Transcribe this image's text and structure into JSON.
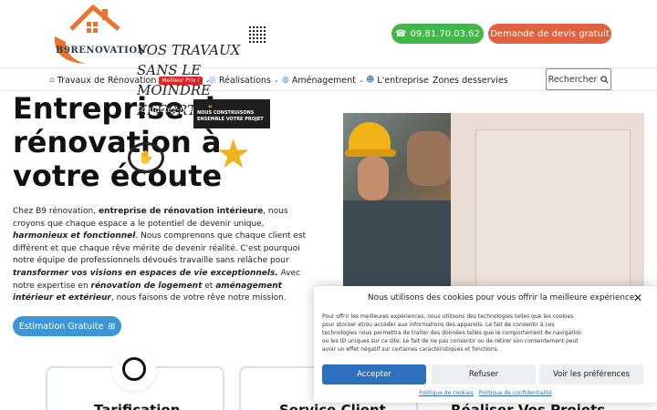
{
  "header": {
    "logo_text": "B9RENOVATION",
    "phone_label": "09.81.70.03.62",
    "quote_label": "Demande de devis gratuit"
  },
  "nav": {
    "items": [
      {
        "label": "Travaux de Rénovation",
        "icon": "home-icon",
        "badge": "Meilleur Prix !"
      },
      {
        "label": "Réalisations",
        "icon": "check-circle-icon"
      },
      {
        "label": "Aménagement",
        "icon": "compass-icon"
      },
      {
        "label": "L'entreprise",
        "icon": "users-icon"
      },
      {
        "label": "Zones desservies"
      }
    ],
    "search_label": "Rechercher"
  },
  "hero": {
    "title": "Entreprise de rénovation à votre écoute",
    "p1": "Chez B9 rénovation, ",
    "p2": "entreprise de rénovation intérieure",
    "p3": ", nous croyons que chaque espace a le potentiel de devenir unique, ",
    "p4": "harmonieux et fonctionnel",
    "p5": ". Nous comprenons que chaque client est différent et que chaque rêve mérite de devenir réalité. C'est pourquoi notre équipe de professionnels dévoués travaille sans relâche pour ",
    "p6": "transformer vos visions en espaces de vie exceptionnels.",
    "p7": " Avec notre expertise en ",
    "p8": "rénovation de logement",
    "p9": " et ",
    "p10": "aménagement intérieur et extérieur",
    "p11": ", nous faisons de votre rêve notre mission.",
    "estimate_label": "Estimation Gratuite"
  },
  "promo": {
    "heading": "VOS TRAVAUX SANS LE MOINDRE EFFORT",
    "script": "Contactez-nous",
    "box_text": "NOUS CONSTRUISONS ENSEMBLE VOTRE PROJET"
  },
  "features": [
    {
      "label": "Tarification"
    },
    {
      "label": "Service Client"
    },
    {
      "label": "Réaliser Vos Projets"
    }
  ],
  "cookie": {
    "title": "Nous utilisons des cookies pour vous offrir la meilleure expérience.",
    "body": "Pour offrir les meilleures expériences, nous utilisons des technologies telles que les cookies pour stocker et/ou accéder aux informations des appareils. Le fait de consentir à ces technologies nous permettra de traiter des données telles que le comportement de navigation ou les ID uniques sur ce site. Le fait de ne pas consentir ou de retirer son consentement peut avoir un effet négatif sur certaines caractéristiques et fonctions.",
    "accept": "Accepter",
    "refuse": "Refuser",
    "prefs": "Voir les préférences",
    "link1": "Politique de cookies",
    "link2": "Politique de confidentialité"
  },
  "colors": {
    "phone_bg": "#43b649",
    "quote_bg": "#e0613d",
    "estimate_bg": "#3a96d6",
    "accept_bg": "#2e6fbf",
    "logo_orange": "#e8742f"
  }
}
